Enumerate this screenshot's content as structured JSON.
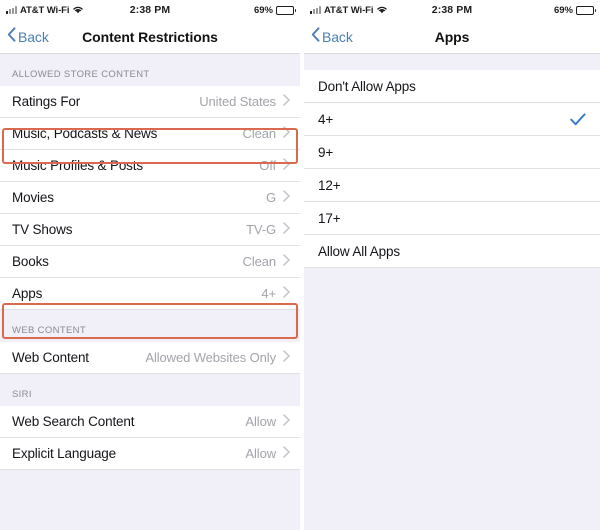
{
  "left_screen": {
    "status_bar": {
      "carrier": "AT&T Wi-Fi",
      "signal_icon": "cellular-signal-icon",
      "wifi_icon": "wifi-icon",
      "time": "2:38 PM",
      "battery_percent": "69%",
      "battery_icon": "battery-icon"
    },
    "nav": {
      "back_label": "Back",
      "back_icon": "chevron-left-icon",
      "title": "Content Restrictions"
    },
    "sections": [
      {
        "header": "ALLOWED STORE CONTENT",
        "rows": [
          {
            "label": "Ratings For",
            "value": "United States",
            "highlighted": false
          },
          {
            "label": "Music, Podcasts & News",
            "value": "Clean",
            "highlighted": true
          },
          {
            "label": "Music Profiles & Posts",
            "value": "Off",
            "highlighted": false
          },
          {
            "label": "Movies",
            "value": "G",
            "highlighted": false
          },
          {
            "label": "TV Shows",
            "value": "TV-G",
            "highlighted": false
          },
          {
            "label": "Books",
            "value": "Clean",
            "highlighted": false
          },
          {
            "label": "Apps",
            "value": "4+",
            "highlighted": true
          }
        ]
      },
      {
        "header": "WEB CONTENT",
        "rows": [
          {
            "label": "Web Content",
            "value": "Allowed Websites Only",
            "highlighted": false
          }
        ]
      },
      {
        "header": "SIRI",
        "rows": [
          {
            "label": "Web Search Content",
            "value": "Allow",
            "highlighted": false
          },
          {
            "label": "Explicit Language",
            "value": "Allow",
            "highlighted": false
          }
        ]
      }
    ]
  },
  "right_screen": {
    "status_bar": {
      "carrier": "AT&T Wi-Fi",
      "signal_icon": "cellular-signal-icon",
      "wifi_icon": "wifi-icon",
      "time": "2:38 PM",
      "battery_percent": "69%",
      "battery_icon": "battery-icon"
    },
    "nav": {
      "back_label": "Back",
      "back_icon": "chevron-left-icon",
      "title": "Apps"
    },
    "options": [
      {
        "label": "Don't Allow Apps",
        "selected": false
      },
      {
        "label": "4+",
        "selected": true
      },
      {
        "label": "9+",
        "selected": false
      },
      {
        "label": "12+",
        "selected": false
      },
      {
        "label": "17+",
        "selected": false
      },
      {
        "label": "Allow All Apps",
        "selected": false
      }
    ],
    "check_icon": "checkmark-icon"
  },
  "colors": {
    "accent_blue": "#3478c6",
    "link_blue": "#4a7fb5",
    "highlight_red": "#d9694f",
    "list_background": "#f1eff8",
    "row_background": "#ffffff",
    "value_gray": "#a3a3ab"
  }
}
